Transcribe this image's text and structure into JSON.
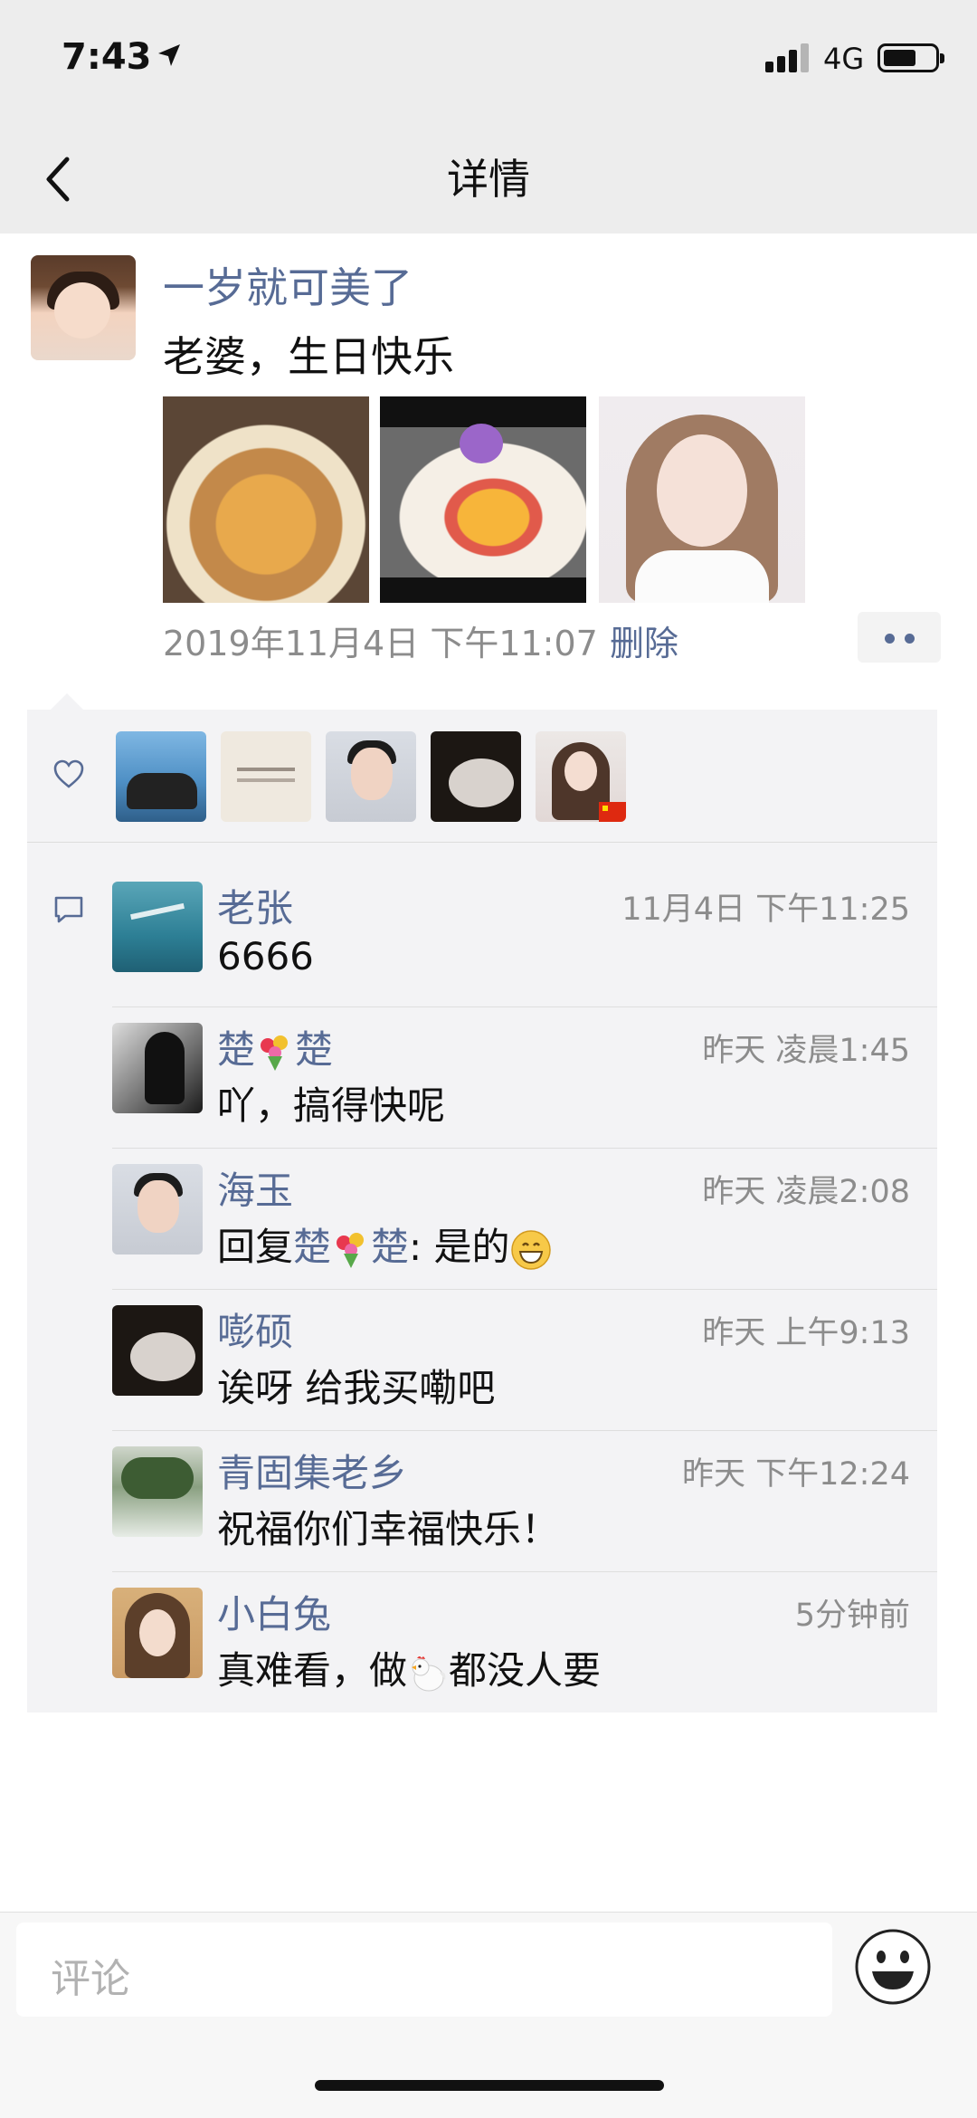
{
  "status_bar": {
    "time": "7:43",
    "network": "4G",
    "signal_bars": 3,
    "battery_level": 0.6
  },
  "nav": {
    "title": "详情",
    "back_icon": "chevron-left-icon"
  },
  "post": {
    "author": "一岁就可美了",
    "text": "老婆，生日快乐",
    "photos": [
      "cake-photo-1",
      "cake-photo-2",
      "selfie-photo"
    ],
    "time": "2019年11月4日 下午11:07",
    "delete_label": "删除"
  },
  "likes": {
    "icon": "heart-outline-icon",
    "count_avatars": 5
  },
  "comments": [
    {
      "name": "老张",
      "time": "11月4日 下午11:25",
      "text": "6666"
    },
    {
      "name_a": "楚",
      "name_b": "楚",
      "time": "昨天 凌晨1:45",
      "text": "吖，搞得快呢"
    },
    {
      "name": "海玉",
      "time": "昨天 凌晨2:08",
      "text_prefix": "回复",
      "reply_to_a": "楚",
      "reply_to_b": "楚",
      "text_suffix": ": 是的"
    },
    {
      "name": "嘭硕",
      "time": "昨天 上午9:13",
      "text": "诶呀  给我买嘞吧"
    },
    {
      "name": "青固集老乡",
      "time": "昨天 下午12:24",
      "text": "祝福你们幸福快乐！"
    },
    {
      "name": "小白兔",
      "time": "5分钟前",
      "text_prefix": "真难看，做",
      "text_suffix": "都没人要"
    }
  ],
  "input": {
    "placeholder": "评论",
    "emoji_icon": "smiley-face-icon"
  }
}
